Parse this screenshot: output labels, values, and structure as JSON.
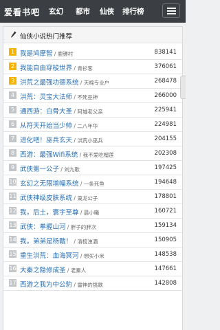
{
  "header": {
    "logo": "爱看书吧",
    "nav": [
      "玄幻",
      "都市",
      "仙侠",
      "排行榜"
    ]
  },
  "panel": {
    "title": "仙侠小说热门推荐"
  },
  "books": [
    {
      "rank": "1",
      "title": "我是鸠摩智",
      "author": "鹿镖村",
      "count": "838141"
    },
    {
      "rank": "2",
      "title": "我能自由穿梭世界",
      "author": "青衫客",
      "count": "376061"
    },
    {
      "rank": "3",
      "title": "洪荒之最强功德系统",
      "author": "天棉专业户",
      "count": "268478"
    },
    {
      "rank": "4",
      "title": "洪荒：灵宝大法师",
      "author": "不死巫神",
      "count": "266000"
    },
    {
      "rank": "5",
      "title": "通西游：白骨大圣",
      "author": "阿城老父亲",
      "count": "225941"
    },
    {
      "rank": "6",
      "title": "从符天开始当少帅",
      "author": "二八年华",
      "count": "224981"
    },
    {
      "rank": "7",
      "title": "进化吧！巫兵玄天",
      "author": "洪荒小巫兵",
      "count": "204155"
    },
    {
      "rank": "8",
      "title": "西游：最强Wifi系统",
      "author": "我不爱吃榴莲",
      "count": "202308"
    },
    {
      "rank": "9",
      "title": "武侠第一公子",
      "author": "刘九歌",
      "count": "197425"
    },
    {
      "rank": "10",
      "title": "玄幻之无限增幅系统",
      "author": "一条死鱼",
      "count": "194648"
    },
    {
      "rank": "11",
      "title": "武侠神级皮肤系统",
      "author": "東龙公子",
      "count": "178801"
    },
    {
      "rank": "12",
      "title": "我，后土，寰宇至尊",
      "author": "晨小曦",
      "count": "160721"
    },
    {
      "rank": "13",
      "title": "武侠：拳握山河",
      "author": "胖子的胖次",
      "count": "159134"
    },
    {
      "rank": "14",
      "title": "我，弟弟是杨戬！",
      "author": "清梳浊酒",
      "count": "150905"
    },
    {
      "rank": "15",
      "title": "重生洪荒：血海冥河",
      "author": "想买小米",
      "count": "148538"
    },
    {
      "rank": "16",
      "title": "大秦之隐修成圣",
      "author": "老秦人",
      "count": "147661"
    },
    {
      "rank": "17",
      "title": "西游之我为中公豹",
      "author": "雷神的挑歌",
      "count": "142808"
    }
  ],
  "colors": {
    "header_bg": "#3b3e42",
    "link": "#2a6fb3",
    "top_rank": "#f4b400",
    "rank": "#c3c6c9"
  },
  "icons": {
    "menu": "hamburger-menu-icon",
    "panel": "pen-icon"
  }
}
